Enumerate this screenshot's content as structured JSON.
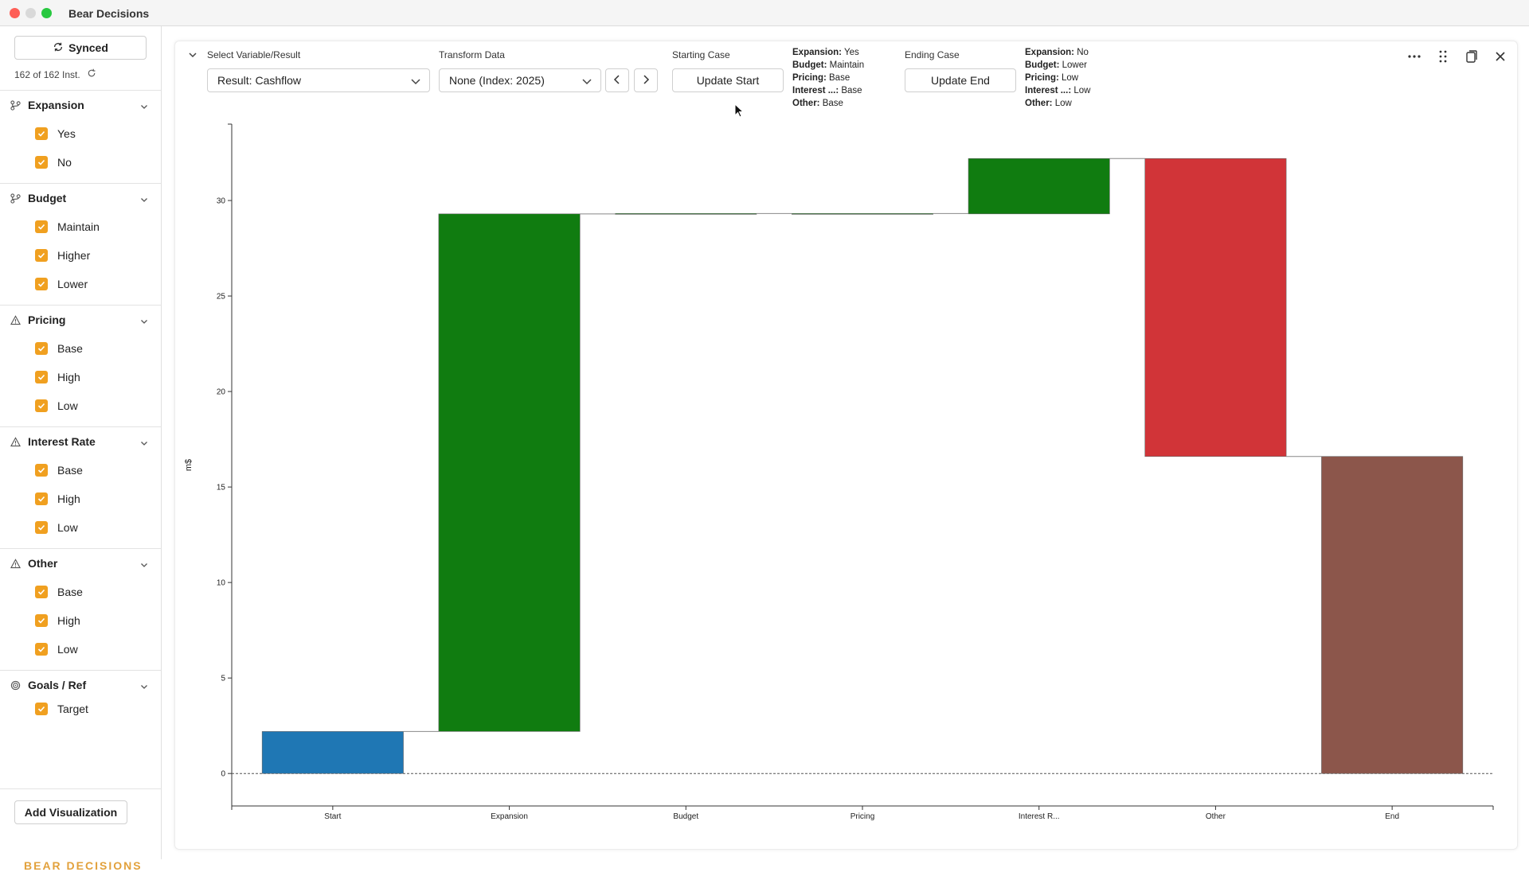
{
  "window": {
    "title": "Bear Decisions"
  },
  "sidebar": {
    "sync_label": "Synced",
    "instances": "162 of 162 Inst.",
    "groups": [
      {
        "label": "Expansion",
        "icon": "branch-icon",
        "options": [
          "Yes",
          "No"
        ]
      },
      {
        "label": "Budget",
        "icon": "branch-icon",
        "options": [
          "Maintain",
          "Higher",
          "Lower"
        ]
      },
      {
        "label": "Pricing",
        "icon": "warning-icon",
        "options": [
          "Base",
          "High",
          "Low"
        ]
      },
      {
        "label": "Interest Rate",
        "icon": "warning-icon",
        "options": [
          "Base",
          "High",
          "Low"
        ]
      },
      {
        "label": "Other",
        "icon": "warning-icon",
        "options": [
          "Base",
          "High",
          "Low"
        ]
      },
      {
        "label": "Goals / Ref",
        "icon": "target-icon",
        "options": [
          "Target"
        ]
      }
    ],
    "add_visualization": "Add Visualization",
    "brand": "BEAR DECISIONS"
  },
  "controls": {
    "select_variable_label": "Select Variable/Result",
    "select_variable_value": "Result: Cashflow",
    "transform_label": "Transform Data",
    "transform_value": "None (Index: 2025)",
    "starting_case_label": "Starting Case",
    "update_start": "Update Start",
    "ending_case_label": "Ending Case",
    "update_end": "Update End",
    "start_case": [
      {
        "k": "Expansion:",
        "v": "Yes"
      },
      {
        "k": "Budget:",
        "v": "Maintain"
      },
      {
        "k": "Pricing:",
        "v": "Base"
      },
      {
        "k": "Interest ...:",
        "v": "Base"
      },
      {
        "k": "Other:",
        "v": "Base"
      }
    ],
    "end_case": [
      {
        "k": "Expansion:",
        "v": "No"
      },
      {
        "k": "Budget:",
        "v": "Lower"
      },
      {
        "k": "Pricing:",
        "v": "Low"
      },
      {
        "k": "Interest ...:",
        "v": "Low"
      },
      {
        "k": "Other:",
        "v": "Low"
      }
    ]
  },
  "chart_data": {
    "type": "bar",
    "subtype": "waterfall",
    "ylabel": "m$",
    "xlabel": "",
    "title": "",
    "ylim": [
      -1.7,
      34
    ],
    "yticks": [
      0,
      5,
      10,
      15,
      20,
      25,
      30
    ],
    "categories": [
      "Start",
      "Expansion",
      "Budget",
      "Pricing",
      "Interest R...",
      "Other",
      "End"
    ],
    "bars": [
      {
        "category": "Start",
        "base": 0,
        "value": 2.2,
        "color": "#1f77b4"
      },
      {
        "category": "Expansion",
        "base": 2.2,
        "value": 27.1,
        "color": "#107c10"
      },
      {
        "category": "Budget",
        "base": 29.3,
        "value": 0.02,
        "color": "#107c10"
      },
      {
        "category": "Pricing",
        "base": 29.3,
        "value": 0.02,
        "color": "#107c10"
      },
      {
        "category": "Interest R...",
        "base": 29.3,
        "value": 2.9,
        "color": "#107c10"
      },
      {
        "category": "Other",
        "base": 32.2,
        "value": -15.6,
        "color": "#d13438"
      },
      {
        "category": "End",
        "base": 0,
        "value": 16.6,
        "color": "#8c564b"
      }
    ],
    "zero_line": "dashed",
    "grid": false
  }
}
